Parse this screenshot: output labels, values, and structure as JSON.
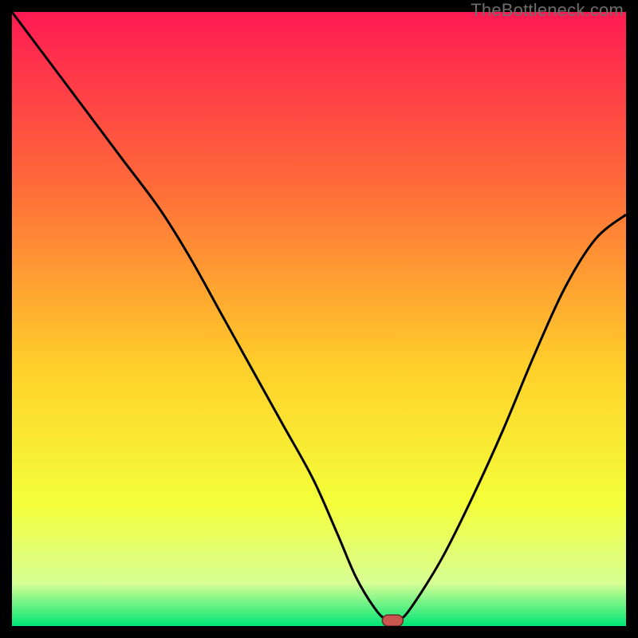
{
  "watermark": "TheBottleneck.com",
  "colors": {
    "gradient_top": "#ff1a52",
    "gradient_upper_mid": "#ff6a3a",
    "gradient_mid": "#ffd02a",
    "gradient_lower_mid": "#f4ff3a",
    "gradient_lower": "#d8ff95",
    "gradient_bottom": "#00e676",
    "curve": "#000000",
    "marker_fill": "#c9564f",
    "marker_stroke": "#6b2a24",
    "frame": "#000000"
  },
  "chart_data": {
    "type": "line",
    "title": "",
    "xlabel": "",
    "ylabel": "",
    "xlim": [
      0,
      100
    ],
    "ylim": [
      0,
      100
    ],
    "x": [
      0,
      6,
      12,
      18,
      24,
      29,
      34,
      39,
      44,
      49,
      53,
      56,
      59,
      61,
      63,
      65,
      70,
      75,
      80,
      85,
      90,
      95,
      100
    ],
    "y": [
      100,
      92,
      84,
      76,
      68,
      60,
      51,
      42,
      33,
      24,
      15,
      8,
      3,
      1,
      1,
      3,
      11,
      21,
      32,
      44,
      55,
      63,
      67
    ],
    "marker": {
      "x": 62,
      "y": 0.5
    },
    "annotations": []
  }
}
